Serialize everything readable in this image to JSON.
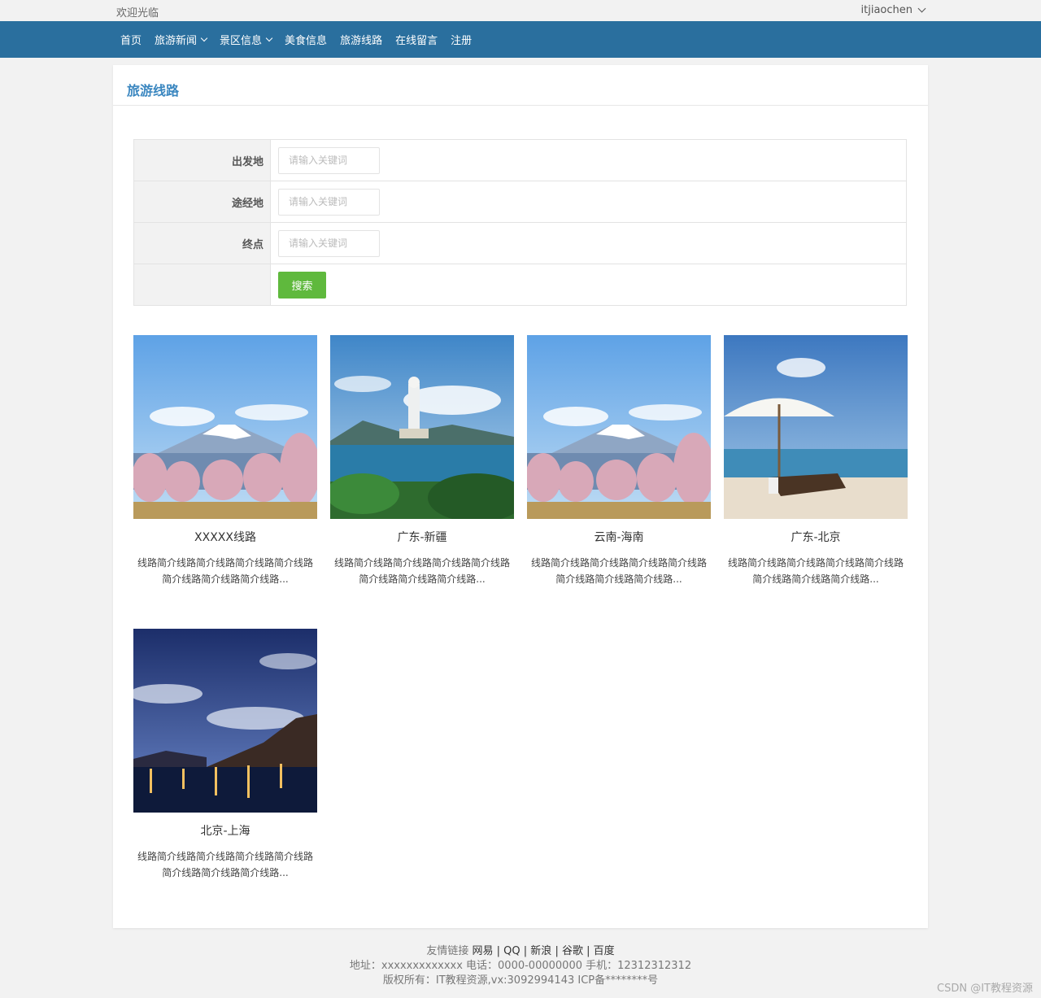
{
  "topbar": {
    "welcome": "欢迎光临",
    "username": "itjiaochen"
  },
  "nav": {
    "items": [
      {
        "label": "首页"
      },
      {
        "label": "旅游新闻"
      },
      {
        "label": "景区信息"
      },
      {
        "label": "美食信息"
      },
      {
        "label": "旅游线路"
      },
      {
        "label": "在线留言"
      },
      {
        "label": "注册"
      }
    ]
  },
  "page": {
    "title": "旅游线路"
  },
  "search": {
    "depart_label": "出发地",
    "via_label": "途经地",
    "end_label": "终点",
    "placeholder": "请输入关键词",
    "button": "搜索"
  },
  "routes": [
    {
      "name": "XXXXX线路",
      "desc": "线路简介线路简介线路简介线路简介线路简介线路简介线路简介线路...",
      "scene": "mountain"
    },
    {
      "name": "广东-新疆",
      "desc": "线路简介线路简介线路简介线路简介线路简介线路简介线路简介线路...",
      "scene": "statue"
    },
    {
      "name": "云南-海南",
      "desc": "线路简介线路简介线路简介线路简介线路简介线路简介线路简介线路...",
      "scene": "mountain"
    },
    {
      "name": "广东-北京",
      "desc": "线路简介线路简介线路简介线路简介线路简介线路简介线路简介线路...",
      "scene": "beach"
    },
    {
      "name": "北京-上海",
      "desc": "线路简介线路简介线路简介线路简介线路简介线路简介线路简介线路...",
      "scene": "night"
    }
  ],
  "footer": {
    "links_label": "友情链接",
    "links": [
      "网易",
      "QQ",
      "新浪",
      "谷歌",
      "百度"
    ],
    "sep": "|",
    "contact": "地址：xxxxxxxxxxxxx 电话：0000-00000000 手机：12312312312",
    "copyright": "版权所有：IT教程资源,vx:3092994143 ICP备********号"
  },
  "watermark": "CSDN @IT教程资源"
}
